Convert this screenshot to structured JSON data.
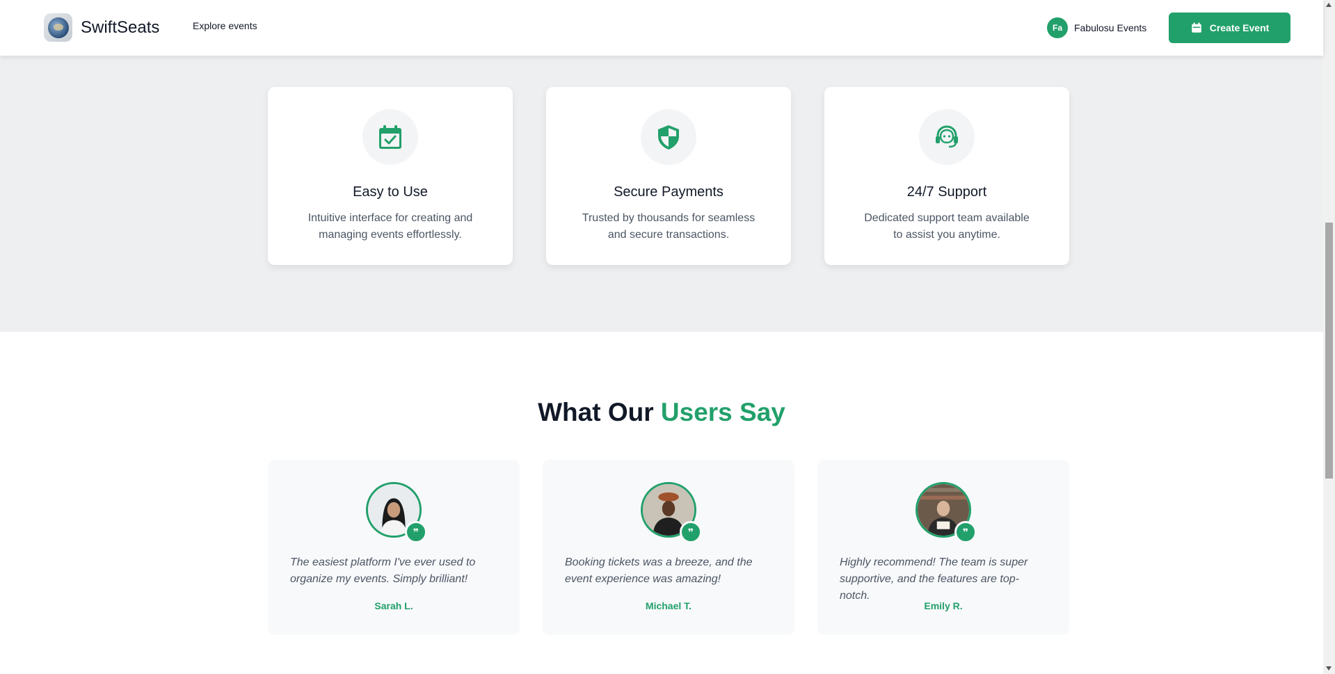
{
  "header": {
    "brand": "SwiftSeats",
    "nav_explore": "Explore events",
    "user_initials": "Fa",
    "user_name": "Fabulosu Events",
    "create_button": "Create Event"
  },
  "features": [
    {
      "icon": "calendar-check-icon",
      "title": "Easy to Use",
      "description": "Intuitive interface for creating and managing events effortlessly."
    },
    {
      "icon": "shield-icon",
      "title": "Secure Payments",
      "description": "Trusted by thousands for seamless and secure transactions."
    },
    {
      "icon": "headset-support-icon",
      "title": "24/7 Support",
      "description": "Dedicated support team available to assist you anytime."
    }
  ],
  "testimonials_section": {
    "title_prefix": "What Our ",
    "title_accent": "Users Say"
  },
  "testimonials": [
    {
      "quote": "The easiest platform I've ever used to organize my events. Simply brilliant!",
      "name": "Sarah L."
    },
    {
      "quote": "Booking tickets was a breeze, and the event experience was amazing!",
      "name": "Michael T."
    },
    {
      "quote": "Highly recommend! The team is super supportive, and the features are top-notch.",
      "name": "Emily R."
    }
  ],
  "colors": {
    "accent": "#22a06b",
    "section_bg": "#eeeff1",
    "card_bg": "#ffffff",
    "testimonial_bg": "#f8f9fb"
  }
}
